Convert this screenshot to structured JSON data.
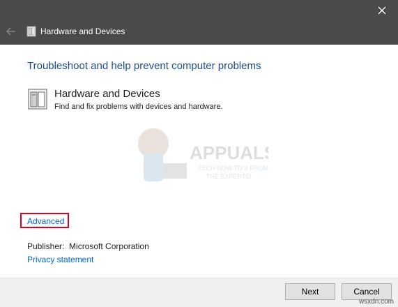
{
  "window": {
    "title": "Hardware and Devices",
    "close_glyph": "✕",
    "back_icon": "back-arrow-icon"
  },
  "main": {
    "heading": "Troubleshoot and help prevent computer problems",
    "troubleshooter": {
      "name": "Hardware and Devices",
      "description": "Find and fix problems with devices and hardware.",
      "icon": "hardware-device-icon"
    }
  },
  "watermark": {
    "brand": "APPUALS",
    "tagline_line1": "TECH HOW-TO'S FROM",
    "tagline_line2": "THE EXPERTS!"
  },
  "links": {
    "advanced": "Advanced",
    "privacy": "Privacy statement"
  },
  "publisher": {
    "label": "Publisher:",
    "value": "Microsoft Corporation"
  },
  "footer": {
    "next_label": "Next",
    "cancel_label": "Cancel",
    "site_tag": "wsxdn.com"
  },
  "colors": {
    "titlebar": "#4a4a4a",
    "heading": "#1e4e8c",
    "link": "#0066cc",
    "highlight": "#e0001b"
  }
}
